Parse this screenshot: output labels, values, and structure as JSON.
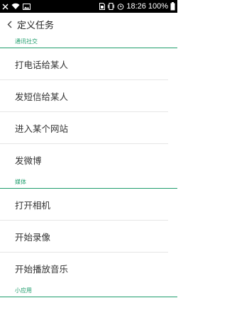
{
  "status_bar": {
    "time": "18:26",
    "battery": "100%",
    "icons": [
      "close-x-icon",
      "wifi-icon",
      "image-icon",
      "sim-icon",
      "vibrate-icon",
      "alarm-icon",
      "battery-icon"
    ]
  },
  "header": {
    "title": "定义任务",
    "back_icon": "chevron-left-icon"
  },
  "sections": [
    {
      "title": "通讯社交",
      "items": [
        "打电话给某人",
        "发短信给某人",
        "进入某个网站",
        "发微博"
      ]
    },
    {
      "title": "媒体",
      "items": [
        "打开相机",
        "开始录像",
        "开始播放音乐"
      ]
    },
    {
      "title": "小应用",
      "items": []
    }
  ],
  "colors": {
    "accent": "#1f9d6c",
    "divider": "#e6e6e6",
    "status_bar_bg": "#000000"
  }
}
